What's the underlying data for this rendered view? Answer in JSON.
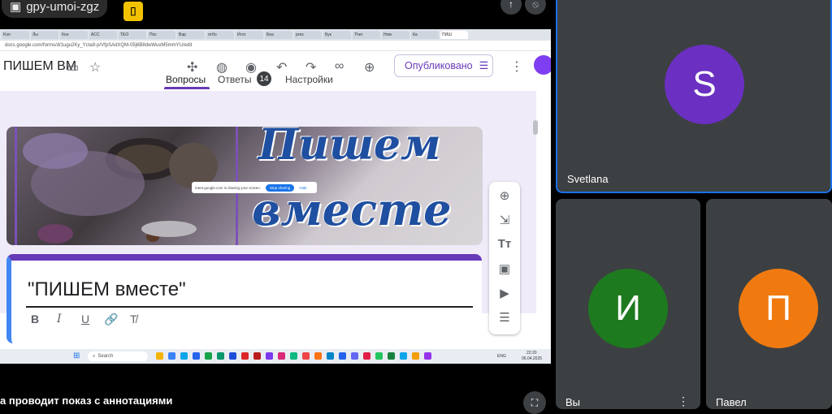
{
  "meet": {
    "meeting_code": "gpy-umoi-zgz",
    "lock_glyph": "⌷",
    "presenting_caption": "а проводит показ с аннотациями"
  },
  "browser": {
    "tabs": [
      "Kon",
      "Лы",
      "Кон",
      "ACC",
      "TEO",
      "Пос",
      "Вар",
      "отбо",
      "Итог",
      "Беа",
      "pres",
      "Бук",
      "Ther",
      "Ном",
      "Ка",
      "ПИШ"
    ],
    "url": "docs.google.com/forms/d/1ugu2Ky_Ycta9-p/VfpSAdXQM-05j6B8dwWuxM5mmYU/edit"
  },
  "forms": {
    "doc_title": "ПИШЕМ ВМ",
    "publish_label": "Опубликовано",
    "tabs": {
      "questions": "Вопросы",
      "answers": "Ответы",
      "answers_count": "14",
      "settings": "Настройки"
    },
    "banner_line1": "Пишем",
    "banner_line2": "вместе",
    "share_notice": "meet.google.com is sharing your screen.",
    "share_stop": "Stop sharing",
    "share_hide": "Hide",
    "form_title": "\"ПИШЕМ вместе\"",
    "format_tools": [
      "B",
      "I",
      "U",
      "🔗",
      "T̸"
    ],
    "side_tools": [
      "⊕",
      "⇲",
      "Tт",
      "▣",
      "▶",
      "☰"
    ]
  },
  "taskbar": {
    "search_placeholder": "Search",
    "lang": "ENG",
    "time": "22:20",
    "date": "06.04.2025"
  },
  "participants": [
    {
      "name": "Svetlana",
      "initial": "S",
      "color": "#6b2fc1"
    },
    {
      "name": "Вы",
      "initial": "И",
      "color": "#1e7a1e"
    },
    {
      "name": "Павел",
      "initial": "П",
      "color": "#f07a10"
    }
  ]
}
